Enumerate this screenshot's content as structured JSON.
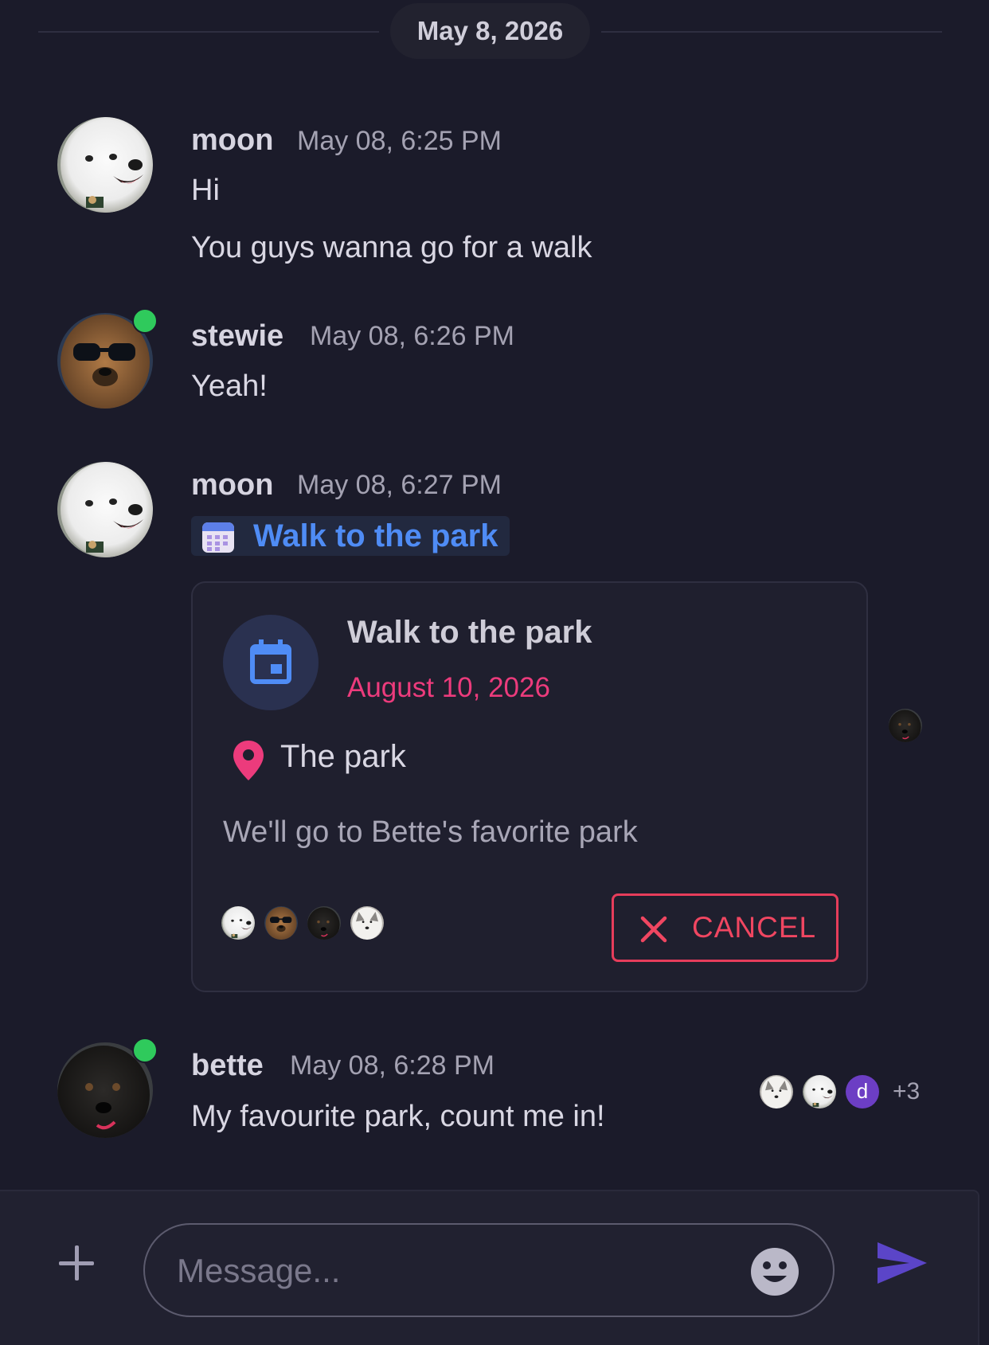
{
  "date_separator": "May 8, 2026",
  "colors": {
    "background": "#1b1b2a",
    "accent_blue": "#4f8cf5",
    "event_date_pink": "#ec3b7c",
    "cancel_red": "#e63d5b",
    "online_green": "#2fca5c",
    "send_purple": "#5b45c8"
  },
  "messages": [
    {
      "author": "moon",
      "time": "May 08, 6:25 PM",
      "lines": [
        "Hi",
        "You guys wanna go for a walk"
      ]
    },
    {
      "author": "stewie",
      "time": "May 08, 6:26 PM",
      "online": true,
      "lines": [
        "Yeah!"
      ]
    },
    {
      "author": "moon",
      "time": "May 08, 6:27 PM",
      "event_link": "Walk to the park"
    },
    {
      "author": "bette",
      "time": "May 08, 6:28 PM",
      "online": true,
      "lines": [
        "My favourite park, count me in!"
      ]
    }
  ],
  "event_card": {
    "title": "Walk to the park",
    "date": "August 10, 2026",
    "location": "The park",
    "description": "We'll go to Bette's favorite park",
    "cancel_label": "CANCEL",
    "participants": [
      "samoyed",
      "sunglasses-dog",
      "black-lab",
      "husky"
    ]
  },
  "read_receipts": {
    "extra_badge": "d",
    "more_count": "+3"
  },
  "composer": {
    "placeholder": "Message..."
  },
  "icons": {
    "add": "plus-icon",
    "emoji": "smiley-icon",
    "send": "send-icon",
    "calendar": "calendar-icon",
    "location": "pin-icon",
    "cancel": "close-icon"
  }
}
